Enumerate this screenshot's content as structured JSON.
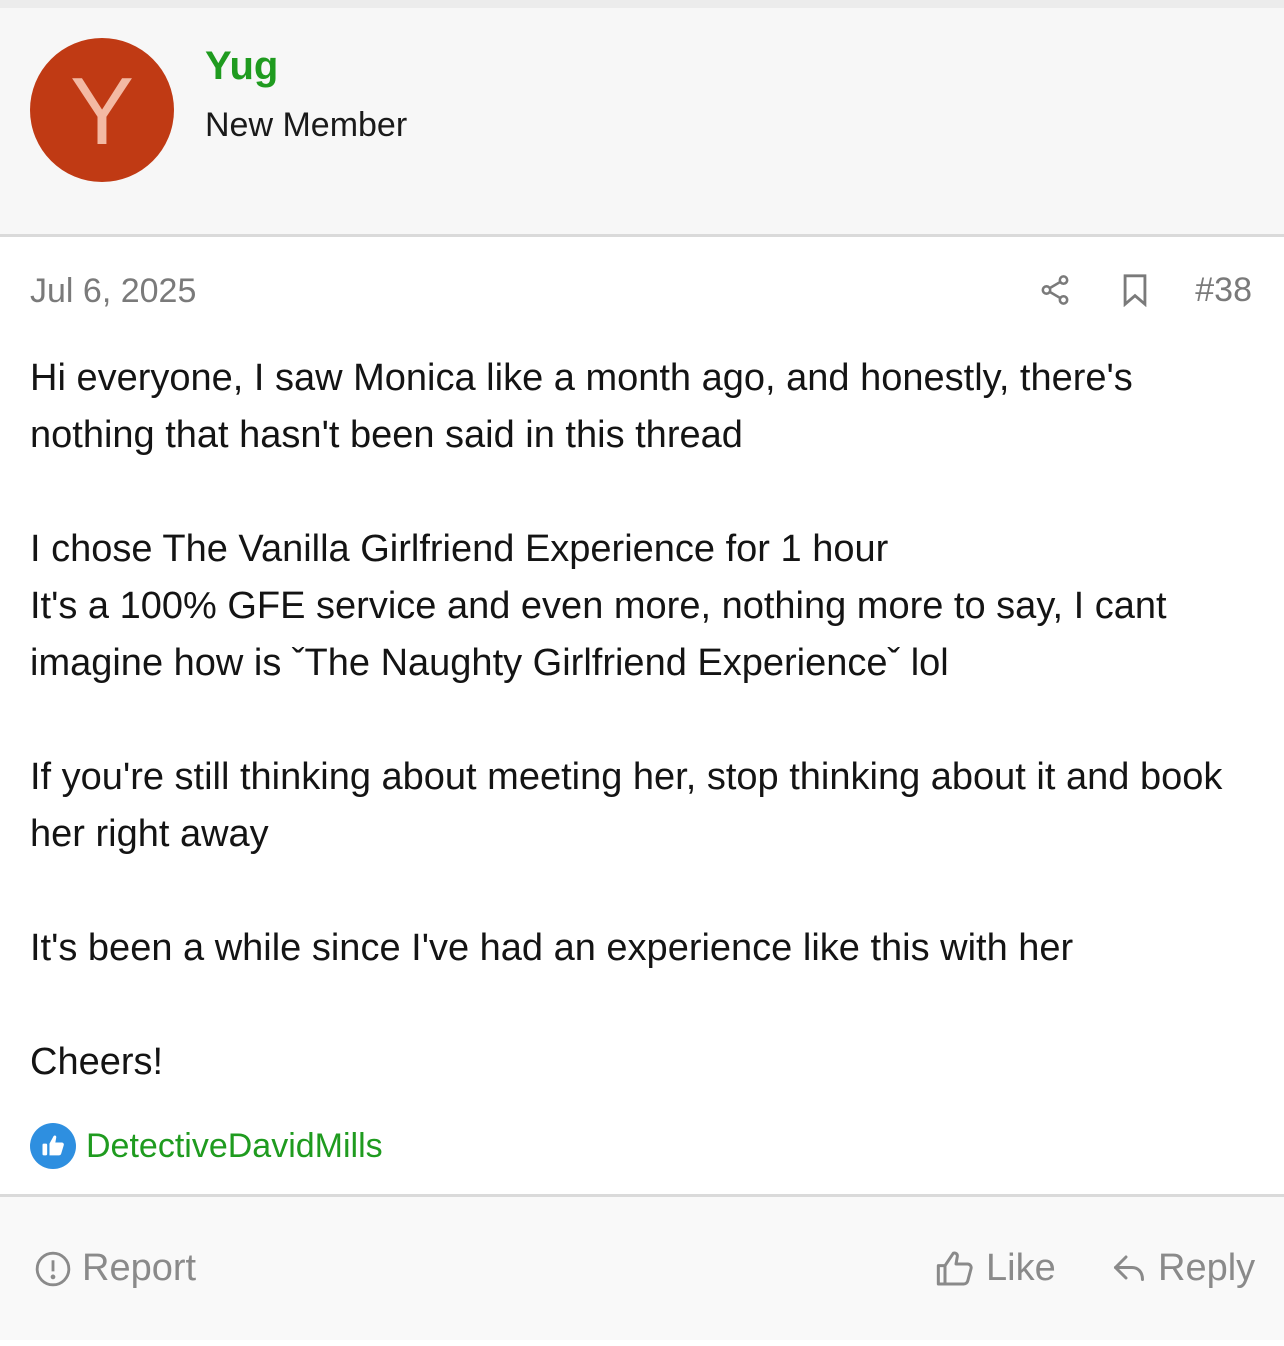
{
  "author": {
    "avatar_letter": "Y",
    "avatar_color": "#c03a14",
    "username": "Yug",
    "username_color": "#1f9b1f",
    "user_title": "New Member"
  },
  "meta": {
    "date": "Jul 6, 2025",
    "share_icon": "share-icon",
    "bookmark_icon": "bookmark-icon",
    "post_number": "#38"
  },
  "body": {
    "paragraphs": [
      "Hi everyone, I saw Monica like a month ago, and honestly, there's nothing that hasn't been said in this thread",
      "I chose The Vanilla Girlfriend Experience for 1 hour\nIt's a 100% GFE service and even more, nothing more to say, I cant imagine how is ˇThe Naughty Girlfriend Experienceˇ lol",
      "If you're still thinking about meeting her, stop thinking about it and book her right away",
      "It's been a while since I've had an experience like this with her",
      "Cheers!"
    ]
  },
  "reactions": {
    "icon": "thumbs-up-badge-icon",
    "users": "DetectiveDavidMills"
  },
  "footer": {
    "report_label": "Report",
    "like_label": "Like",
    "reply_label": "Reply"
  }
}
